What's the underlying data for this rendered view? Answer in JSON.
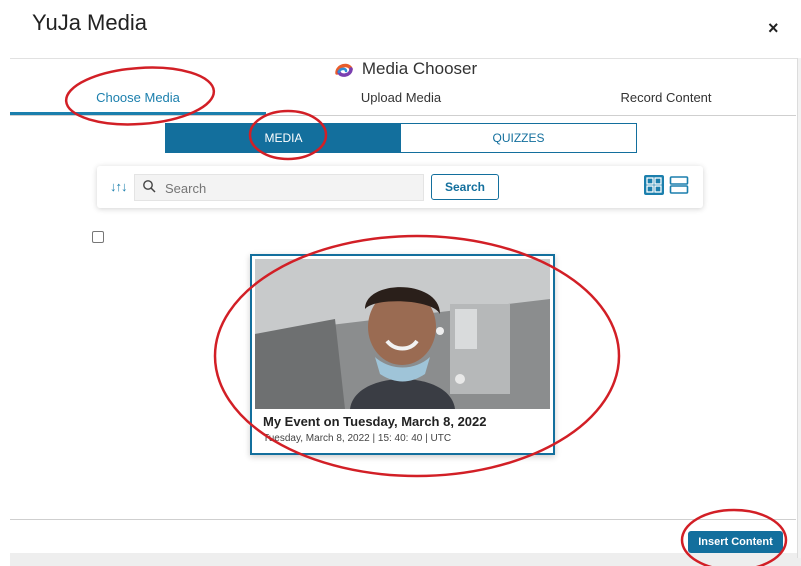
{
  "dialog": {
    "title": "YuJa Media",
    "close": "×"
  },
  "chooser": {
    "title": "Media Chooser"
  },
  "tabs": [
    {
      "label": "Choose Media",
      "active": true
    },
    {
      "label": "Upload Media",
      "active": false
    },
    {
      "label": "Record Content",
      "active": false
    }
  ],
  "segment": {
    "media": "MEDIA",
    "quizzes": "QUIZZES",
    "selected": "MEDIA"
  },
  "search": {
    "placeholder": "Search",
    "value": "",
    "button": "Search"
  },
  "card": {
    "title": "My Event on Tuesday, March 8, 2022",
    "subtitle": "Tuesday, March 8, 2022 | 15: 40: 40 | UTC"
  },
  "footer": {
    "insert": "Insert Content"
  },
  "colors": {
    "accent": "#136f9d",
    "annotation": "#d21f26"
  },
  "icons": [
    "sort-icon",
    "search-icon",
    "grid-view-icon",
    "list-view-icon",
    "media-chooser-logo",
    "close-icon"
  ]
}
